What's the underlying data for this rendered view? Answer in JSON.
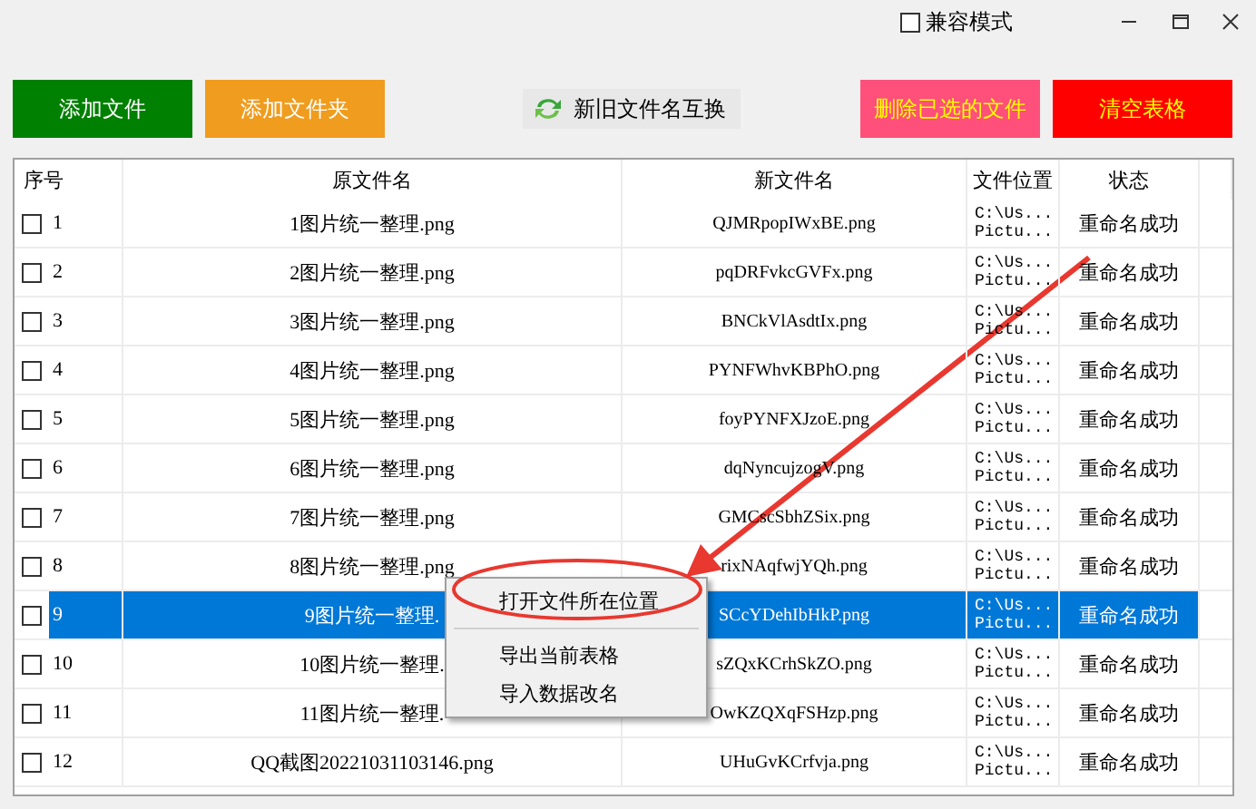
{
  "window": {
    "compat_mode": {
      "label": "兼容模式",
      "checked": false
    }
  },
  "toolbar": [
    {
      "label": "添加文件",
      "kind": "green"
    },
    {
      "label": "添加文件夹",
      "kind": "orange"
    },
    {
      "label": "新旧文件名互换",
      "kind": "swap"
    },
    {
      "label": "删除已选的文件",
      "kind": "pink"
    },
    {
      "label": "清空表格",
      "kind": "red"
    }
  ],
  "table": {
    "columns": [
      "序号",
      "原文件名",
      "新文件名",
      "文件位置",
      "状态"
    ],
    "rows": [
      {
        "index": "1",
        "checked": false,
        "selected": false,
        "original": "1图片统一整理.png",
        "new": "QJMRpopIWxBE.png",
        "location": "C:\\Us...\nPictu...",
        "status": "重命名成功"
      },
      {
        "index": "2",
        "checked": false,
        "selected": false,
        "original": "2图片统一整理.png",
        "new": "pqDRFvkcGVFx.png",
        "location": "C:\\Us...\nPictu...",
        "status": "重命名成功"
      },
      {
        "index": "3",
        "checked": false,
        "selected": false,
        "original": "3图片统一整理.png",
        "new": "BNCkVlAsdtIx.png",
        "location": "C:\\Us...\nPictu...",
        "status": "重命名成功"
      },
      {
        "index": "4",
        "checked": false,
        "selected": false,
        "original": "4图片统一整理.png",
        "new": "PYNFWhvKBPhO.png",
        "location": "C:\\Us...\nPictu...",
        "status": "重命名成功"
      },
      {
        "index": "5",
        "checked": false,
        "selected": false,
        "original": "5图片统一整理.png",
        "new": "foyPYNFXJzoE.png",
        "location": "C:\\Us...\nPictu...",
        "status": "重命名成功"
      },
      {
        "index": "6",
        "checked": false,
        "selected": false,
        "original": "6图片统一整理.png",
        "new": "dqNyncujzogV.png",
        "location": "C:\\Us...\nPictu...",
        "status": "重命名成功"
      },
      {
        "index": "7",
        "checked": false,
        "selected": false,
        "original": "7图片统一整理.png",
        "new": "GMCscSbhZSix.png",
        "location": "C:\\Us...\nPictu...",
        "status": "重命名成功"
      },
      {
        "index": "8",
        "checked": false,
        "selected": false,
        "original": "8图片统一整理.png",
        "new": "rixNAqfwjYQh.png",
        "location": "C:\\Us...\nPictu...",
        "status": "重命名成功"
      },
      {
        "index": "9",
        "checked": false,
        "selected": true,
        "original": "9图片统一整理.",
        "new": "SCcYDehIbHkP.png",
        "location": "C:\\Us...\nPictu...",
        "status": "重命名成功"
      },
      {
        "index": "10",
        "checked": false,
        "selected": false,
        "original": "10图片统一整理.",
        "new": "sZQxKCrhSkZO.png",
        "location": "C:\\Us...\nPictu...",
        "status": "重命名成功"
      },
      {
        "index": "11",
        "checked": false,
        "selected": false,
        "original": "11图片统一整理.",
        "new": "OwKZQXqFSHzp.png",
        "location": "C:\\Us...\nPictu...",
        "status": "重命名成功"
      },
      {
        "index": "12",
        "checked": false,
        "selected": false,
        "original": "QQ截图20221031103146.png",
        "new": "UHuGvKCrfvja.png",
        "location": "C:\\Us...\nPictu...",
        "status": "重命名成功"
      }
    ]
  },
  "context_menu": {
    "items": [
      {
        "label": "打开文件所在位置",
        "kind": "item"
      },
      {
        "kind": "separator"
      },
      {
        "label": "导出当前表格",
        "kind": "item"
      },
      {
        "label": "导入数据改名",
        "kind": "item"
      }
    ]
  }
}
